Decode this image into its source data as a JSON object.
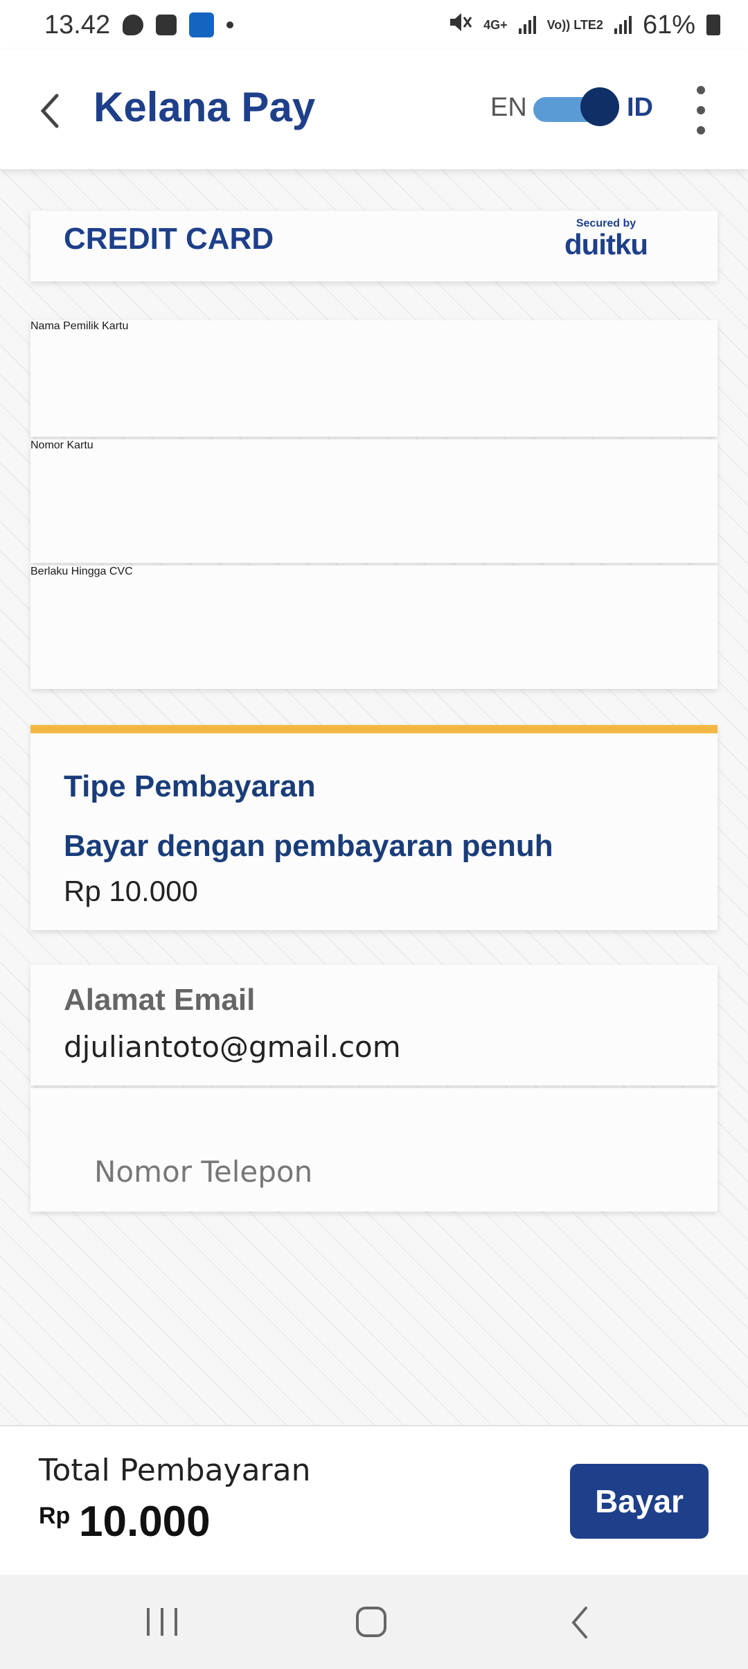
{
  "status_bar": {
    "time": "13.42",
    "network": "4G+",
    "lte": "Vo)) LTE2",
    "battery": "61%"
  },
  "header": {
    "title": "Kelana Pay",
    "lang_en": "EN",
    "lang_id": "ID"
  },
  "credit_card": {
    "title": "CREDIT CARD",
    "secured_by": "Secured by",
    "provider": "duitku"
  },
  "fields": {
    "card_holder_placeholder": "Nama Pemilik Kartu",
    "card_number_placeholder": "Nomor Kartu",
    "expiry_placeholder": "Berlaku Hingga",
    "cvc_placeholder": "CVC",
    "phone_placeholder": "Nomor Telepon"
  },
  "payment_type": {
    "label": "Tipe Pembayaran",
    "mode": "Bayar dengan pembayaran penuh",
    "amount": "Rp 10.000"
  },
  "email": {
    "label": "Alamat Email",
    "value": "djuliantoto@gmail.com"
  },
  "summary": {
    "label": "Total Pembayaran",
    "currency": "Rp",
    "amount": "10.000",
    "pay_label": "Bayar"
  },
  "colors": {
    "brand": "#1e3f8a",
    "accent": "#f3b844"
  }
}
